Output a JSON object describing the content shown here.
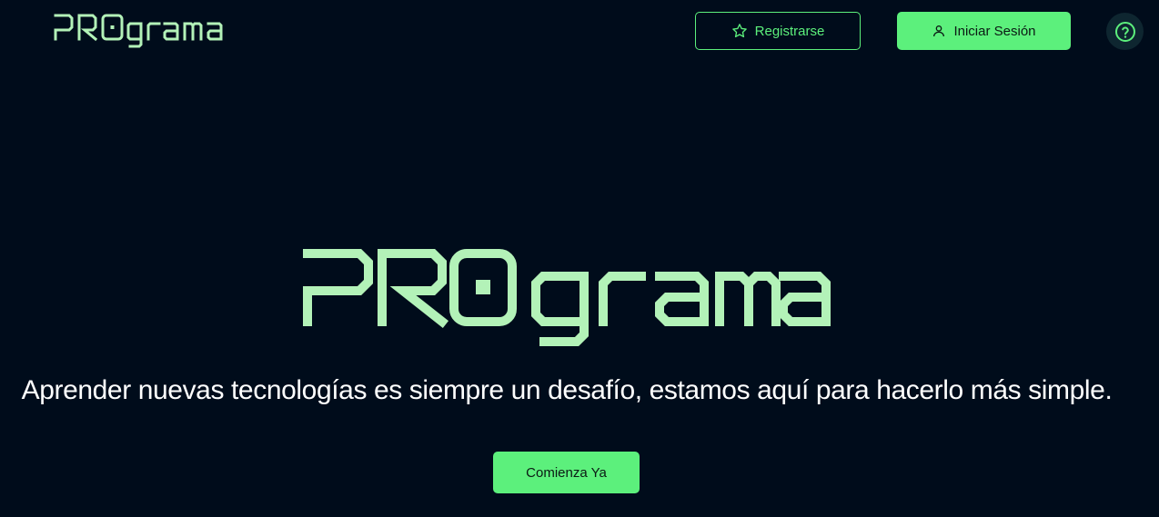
{
  "brand": {
    "name": "PROgrama",
    "logo_color": "#b3f2b8",
    "accent_color": "#5cf07c",
    "background_color": "#000c1b"
  },
  "header": {
    "register_label": "Registrarse",
    "register_icon": "star-icon",
    "login_label": "Iniciar Sesión",
    "login_icon": "user-icon",
    "help_icon": "help-circle-icon"
  },
  "hero": {
    "tagline": "Aprender nuevas tecnologías es siempre un desafío, estamos aquí para hacerlo más simple.",
    "cta_label": "Comienza Ya"
  }
}
